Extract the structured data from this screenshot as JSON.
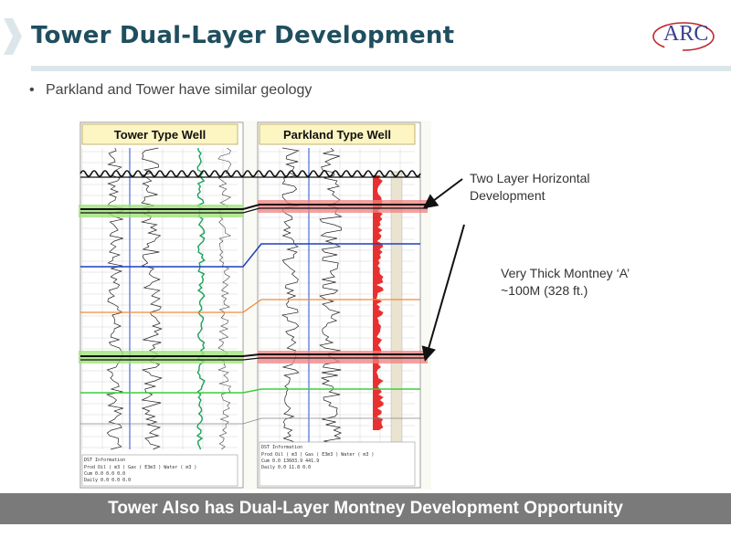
{
  "header": {
    "title": "Tower Dual-Layer Development",
    "logo_text": "ARC"
  },
  "bullets": [
    "Parkland and Tower have similar geology"
  ],
  "figure": {
    "left_panel_title": "Tower Type Well",
    "right_panel_title": "Parkland Type Well",
    "left_info_title": "DST Information",
    "right_info_title": "DST Information",
    "left_info_rows": [
      "Prod  Oil ( m3 )  Gas ( E3m3 )  Water ( m3 )",
      "Cum        0.0        0.0        0.0",
      "Daily      0.0        0.0        0.0"
    ],
    "right_info_rows": [
      "Prod  Oil ( m3 )  Gas ( E3m3 )  Water ( m3 )",
      "Cum        0.0    13603.9     441.9",
      "Daily      0.0       11.8       0.0"
    ]
  },
  "callouts": {
    "two_layer": [
      "Two Layer Horizontal",
      "Development"
    ],
    "thick": [
      "Very Thick Montney ‘A’",
      "~100M (328 ft.)"
    ]
  },
  "footer": {
    "text": "Tower Also has Dual-Layer Montney Development Opportunity"
  },
  "colors": {
    "title": "#1f4e5f",
    "footer_bg": "#7a7a7a",
    "highlight_green": "#9fe37a",
    "highlight_red": "#f08080",
    "horizon_blue": "#1f3fbf",
    "horizon_orange": "#f08a3a",
    "horizon_green": "#3ccf3c"
  }
}
